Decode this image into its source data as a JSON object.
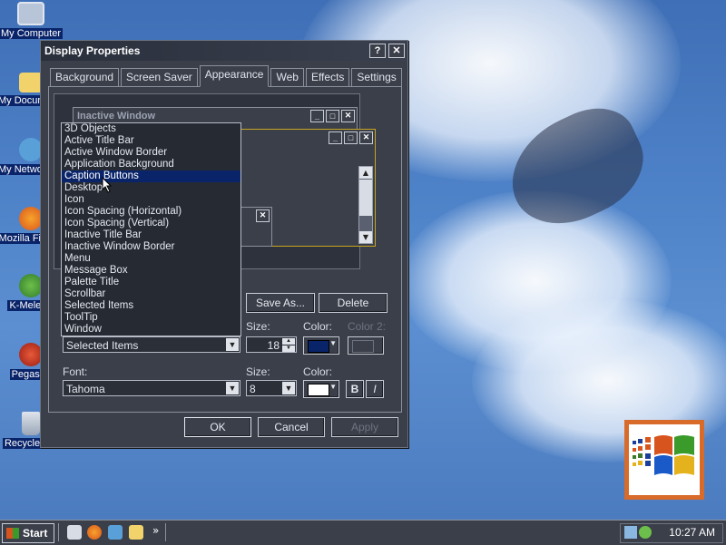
{
  "desktop": {
    "icons": [
      {
        "label": "My Computer",
        "icon": "my-computer-icon"
      },
      {
        "label": "My Documents",
        "icon": "folder-icon"
      },
      {
        "label": "My Network Places",
        "icon": "network-places-icon"
      },
      {
        "label": "Mozilla Firefox",
        "icon": "firefox-icon"
      },
      {
        "label": "K-Meleon",
        "icon": "k-meleon-icon"
      },
      {
        "label": "Pegasus",
        "icon": "pegasus-icon"
      },
      {
        "label": "Recycle Bin",
        "icon": "recycle-bin-icon"
      }
    ]
  },
  "window": {
    "title": "Display Properties",
    "help_btn": "?",
    "close_btn": "✕",
    "tabs": [
      "Background",
      "Screen Saver",
      "Appearance",
      "Web",
      "Effects",
      "Settings"
    ],
    "active_tab": "Appearance",
    "preview": {
      "inactive_title": "Inactive Window",
      "min": "_",
      "max": "□",
      "close": "✕"
    },
    "item_list": [
      "3D Objects",
      "Active Title Bar",
      "Active Window Border",
      "Application Background",
      "Caption Buttons",
      "Desktop",
      "Icon",
      "Icon Spacing (Horizontal)",
      "Icon Spacing (Vertical)",
      "Inactive Title Bar",
      "Inactive Window Border",
      "Menu",
      "Message Box",
      "Palette Title",
      "Scrollbar",
      "Selected Items",
      "ToolTip",
      "Window"
    ],
    "selected_list_item": "Caption Buttons",
    "save_as": "Save As...",
    "delete": "Delete",
    "size_label": "Size:",
    "color_label": "Color:",
    "color2_label": "Color 2:",
    "item_value": "Selected Items",
    "item_size": "18",
    "item_color": "#0a246a",
    "font_label": "Font:",
    "font_value": "Tahoma",
    "font_size_label": "Size:",
    "font_size_value": "8",
    "font_color_label": "Color:",
    "font_color": "#ffffff",
    "bold": "B",
    "italic": "I",
    "ok": "OK",
    "cancel": "Cancel",
    "apply": "Apply"
  },
  "taskbar": {
    "start": "Start",
    "quick_launch": [
      "show-desktop-icon",
      "firefox-icon",
      "network-icon",
      "explorer-icon"
    ],
    "chevron": "»",
    "clock": "10:27 AM"
  },
  "colors": {
    "selection": "#0a246a",
    "window_bg": "#3b3f4a",
    "sky": "#4e82c8"
  }
}
